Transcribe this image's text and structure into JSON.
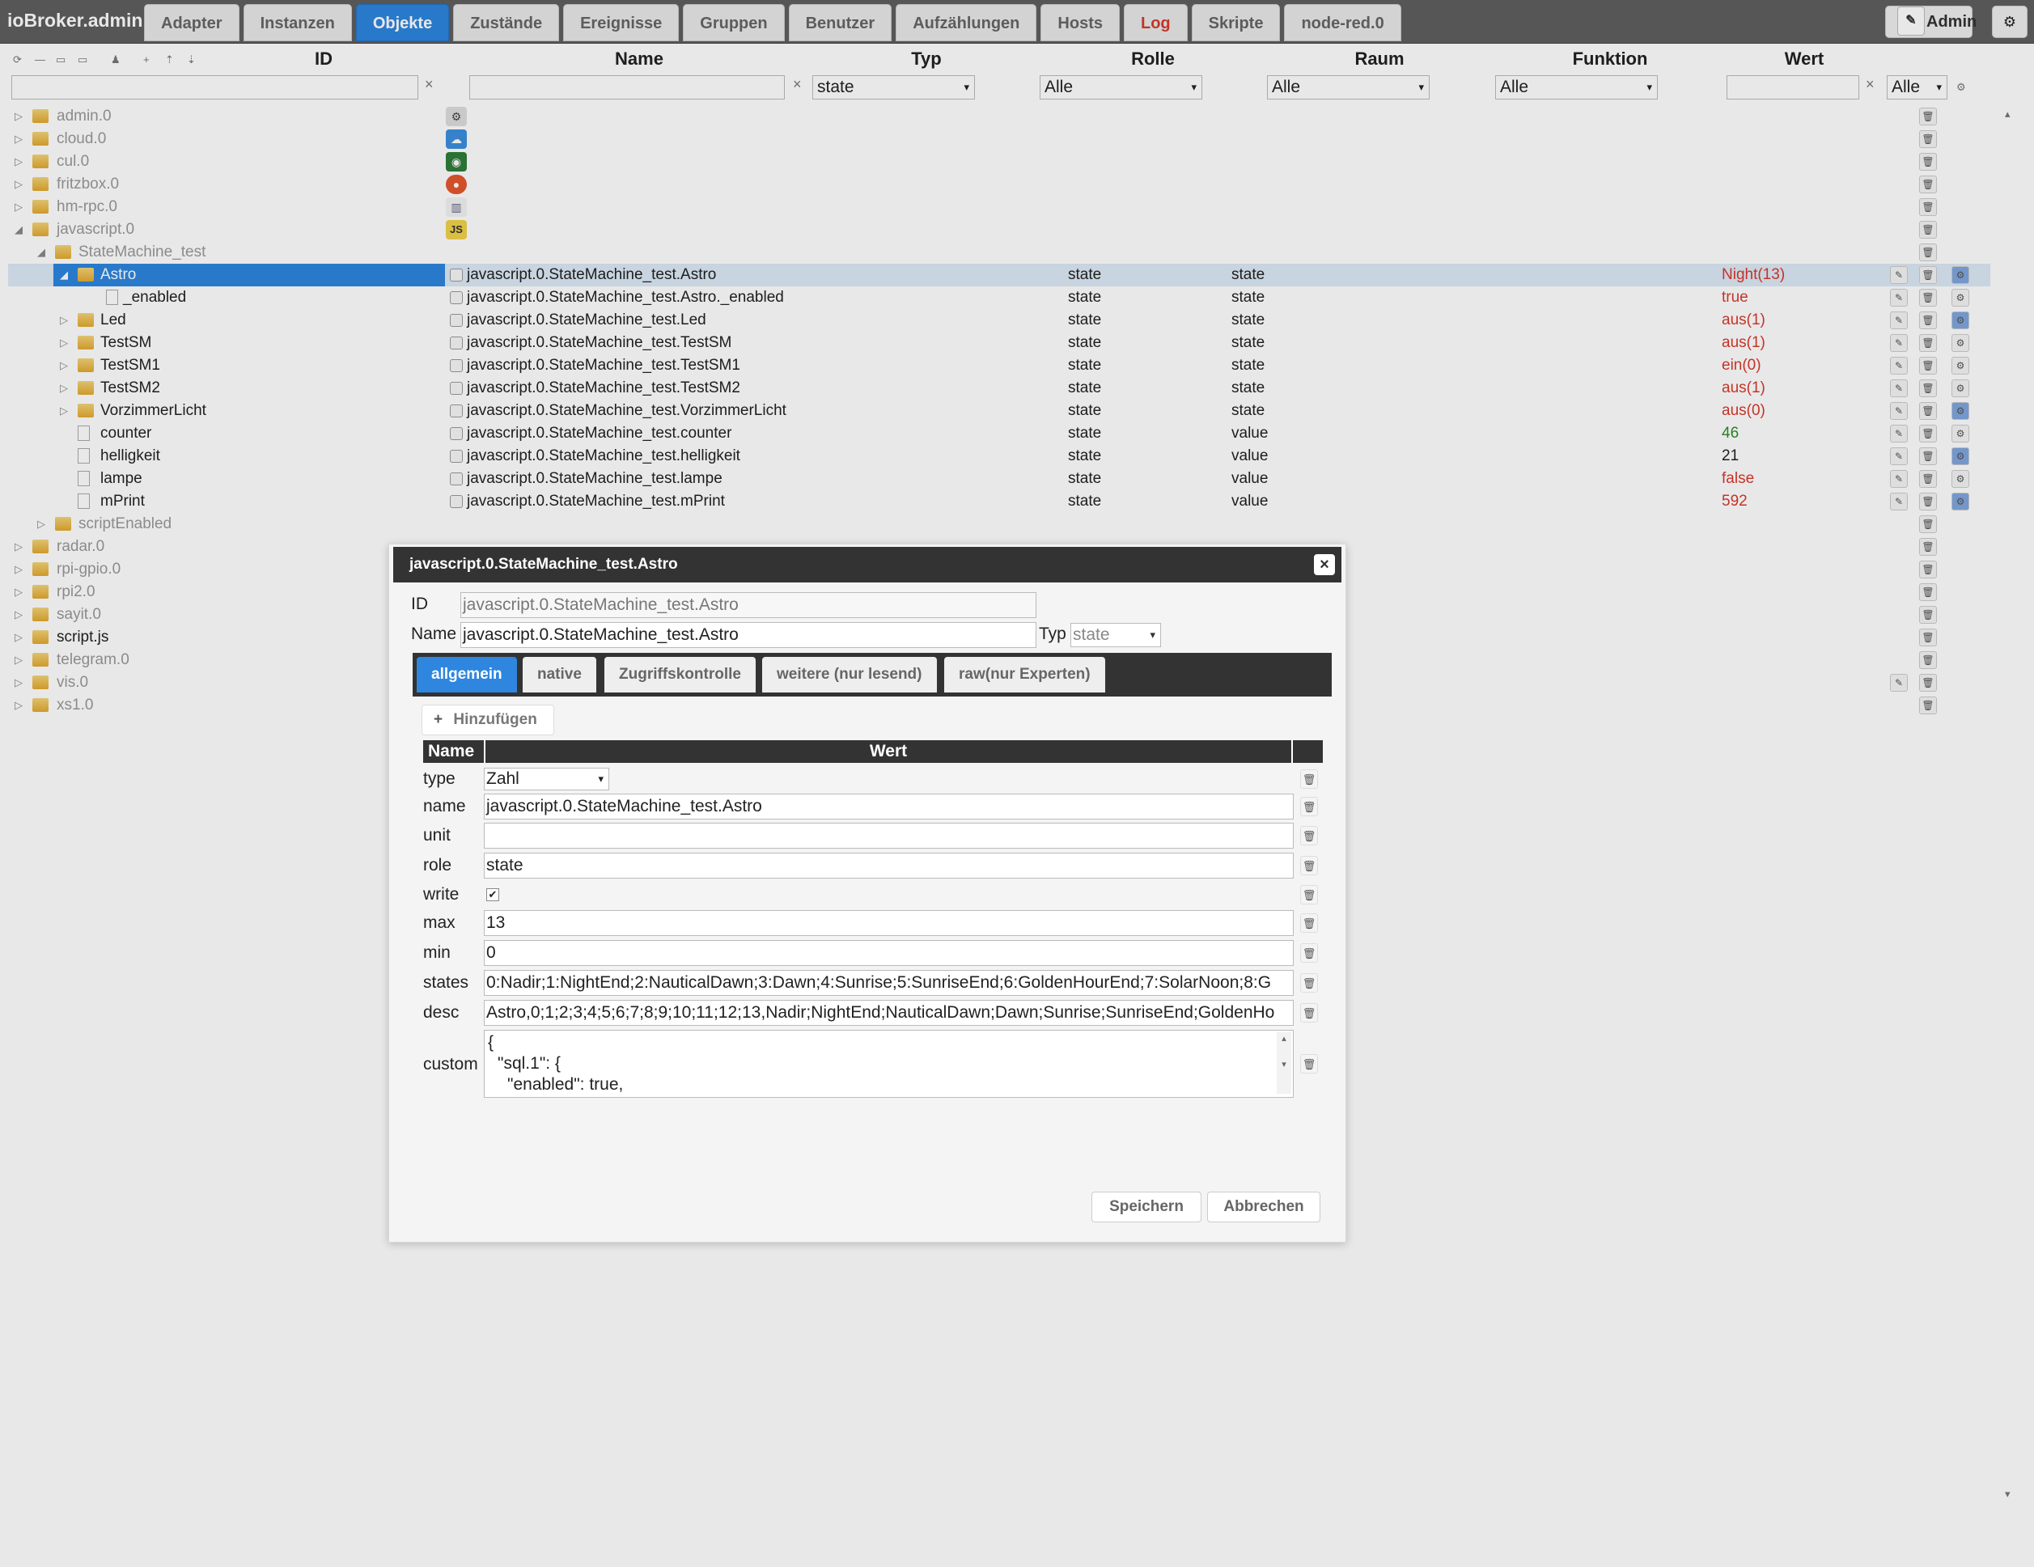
{
  "app": {
    "title": "ioBroker.admin"
  },
  "nav": {
    "tabs": [
      {
        "label": "Adapter"
      },
      {
        "label": "Instanzen"
      },
      {
        "label": "Objekte"
      },
      {
        "label": "Zustände"
      },
      {
        "label": "Ereignisse"
      },
      {
        "label": "Gruppen"
      },
      {
        "label": "Benutzer"
      },
      {
        "label": "Aufzählungen"
      },
      {
        "label": "Hosts"
      },
      {
        "label": "Log"
      },
      {
        "label": "Skripte"
      },
      {
        "label": "node-red.0"
      }
    ],
    "active": "Objekte",
    "user": "Admin"
  },
  "columns": {
    "id": "ID",
    "name": "Name",
    "typ": "Typ",
    "rolle": "Rolle",
    "raum": "Raum",
    "funktion": "Funktion",
    "wert": "Wert"
  },
  "filters": {
    "typ": "state",
    "rolle": "Alle",
    "raum": "Alle",
    "funktion": "Alle",
    "wert": "Alle",
    "clear": "×",
    "arrow": "▾"
  },
  "tree": {
    "adapters": [
      {
        "label": "admin.0",
        "icon": "gear-icon"
      },
      {
        "label": "cloud.0",
        "icon": "cloud-icon"
      },
      {
        "label": "cul.0",
        "icon": "radio-icon"
      },
      {
        "label": "fritzbox.0",
        "icon": "router-icon"
      },
      {
        "label": "hm-rpc.0",
        "icon": "building-icon"
      },
      {
        "label": "javascript.0",
        "icon": "js-icon",
        "icon_text": "JS"
      }
    ],
    "folder": "StateMachine_test",
    "objects": [
      {
        "label": "Astro",
        "id": "javascript.0.StateMachine_test.Astro",
        "typ": "state",
        "rolle": "state",
        "wert": "Night(13)",
        "color": "red"
      },
      {
        "label": "_enabled",
        "id": "javascript.0.StateMachine_test.Astro._enabled",
        "typ": "state",
        "rolle": "state",
        "wert": "true",
        "color": "red"
      },
      {
        "label": "Led",
        "id": "javascript.0.StateMachine_test.Led",
        "typ": "state",
        "rolle": "state",
        "wert": "aus(1)",
        "color": "red"
      },
      {
        "label": "TestSM",
        "id": "javascript.0.StateMachine_test.TestSM",
        "typ": "state",
        "rolle": "state",
        "wert": "aus(1)",
        "color": "red"
      },
      {
        "label": "TestSM1",
        "id": "javascript.0.StateMachine_test.TestSM1",
        "typ": "state",
        "rolle": "state",
        "wert": "ein(0)",
        "color": "red"
      },
      {
        "label": "TestSM2",
        "id": "javascript.0.StateMachine_test.TestSM2",
        "typ": "state",
        "rolle": "state",
        "wert": "aus(1)",
        "color": "red"
      },
      {
        "label": "VorzimmerLicht",
        "id": "javascript.0.StateMachine_test.VorzimmerLicht",
        "typ": "state",
        "rolle": "state",
        "wert": "aus(0)",
        "color": "red"
      },
      {
        "label": "counter",
        "id": "javascript.0.StateMachine_test.counter",
        "typ": "state",
        "rolle": "value",
        "wert": "46",
        "color": "green"
      },
      {
        "label": "helligkeit",
        "id": "javascript.0.StateMachine_test.helligkeit",
        "typ": "state",
        "rolle": "value",
        "wert": "21",
        "color": "black"
      },
      {
        "label": "lampe",
        "id": "javascript.0.StateMachine_test.lampe",
        "typ": "state",
        "rolle": "value",
        "wert": "false",
        "color": "red"
      },
      {
        "label": "mPrint",
        "id": "javascript.0.StateMachine_test.mPrint",
        "typ": "state",
        "rolle": "value",
        "wert": "592",
        "color": "red"
      }
    ],
    "script_enabled": "scriptEnabled",
    "more_adapters": [
      "radar.0",
      "rpi-gpio.0",
      "rpi2.0",
      "sayit.0",
      "script.js",
      "telegram.0",
      "vis.0",
      "xs1.0"
    ]
  },
  "dialog": {
    "title": "javascript.0.StateMachine_test.Astro",
    "close": "×",
    "id_label": "ID",
    "id_value": "javascript.0.StateMachine_test.Astro",
    "name_label": "Name",
    "name_value": "javascript.0.StateMachine_test.Astro",
    "typ_label": "Typ",
    "typ_value": "state",
    "tabs": [
      "allgemein",
      "native",
      "Zugriffskontrolle",
      "weitere (nur lesend)",
      "raw(nur Experten)"
    ],
    "add_label": "Hinzufügen",
    "table_head": {
      "name": "Name",
      "wert": "Wert"
    },
    "props": {
      "type": {
        "key": "type",
        "value": "Zahl"
      },
      "name": {
        "key": "name",
        "value": "javascript.0.StateMachine_test.Astro"
      },
      "unit": {
        "key": "unit",
        "value": ""
      },
      "role": {
        "key": "role",
        "value": "state"
      },
      "write": {
        "key": "write",
        "value": "✔"
      },
      "max": {
        "key": "max",
        "value": "13"
      },
      "min": {
        "key": "min",
        "value": "0"
      },
      "states": {
        "key": "states",
        "value": "0:Nadir;1:NightEnd;2:NauticalDawn;3:Dawn;4:Sunrise;5:SunriseEnd;6:GoldenHourEnd;7:SolarNoon;8:G"
      },
      "desc": {
        "key": "desc",
        "value": "Astro,0;1;2;3;4;5;6;7;8;9;10;11;12;13,Nadir;NightEnd;NauticalDawn;Dawn;Sunrise;SunriseEnd;GoldenHo"
      },
      "custom": {
        "key": "custom",
        "line1": "{",
        "line2": "\"sql.1\": {",
        "line3": "\"enabled\": true,"
      }
    },
    "save": "Speichern",
    "cancel": "Abbrechen"
  }
}
